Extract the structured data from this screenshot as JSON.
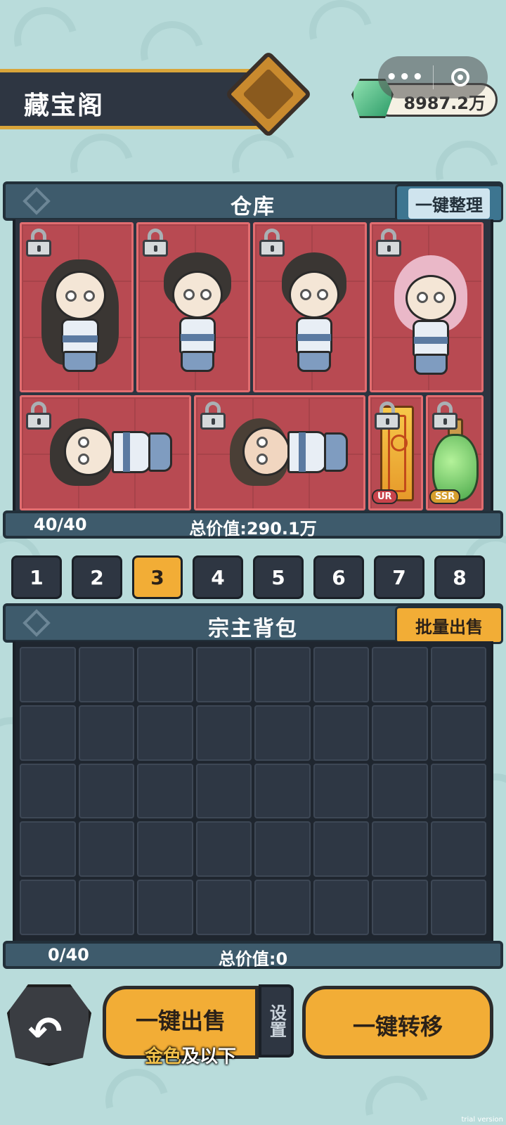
{
  "header": {
    "title": "藏宝阁",
    "currency_value": "8987.2万",
    "capsule_more": "•••"
  },
  "warehouse": {
    "title": "仓库",
    "sort_button": "一键整理",
    "count": "40/40",
    "total_value": "总价值:290.1万",
    "items": [
      {
        "type": "character",
        "locked": true
      },
      {
        "type": "character",
        "locked": true
      },
      {
        "type": "character",
        "locked": true
      },
      {
        "type": "character",
        "locked": true
      },
      {
        "type": "character",
        "locked": true
      },
      {
        "type": "character",
        "locked": true
      },
      {
        "type": "scroll",
        "locked": true,
        "rarity": "UR"
      },
      {
        "type": "bottle",
        "locked": true,
        "rarity": "SSR"
      }
    ]
  },
  "page_tabs": [
    "1",
    "2",
    "3",
    "4",
    "5",
    "6",
    "7",
    "8"
  ],
  "active_tab": "3",
  "backpack": {
    "title": "宗主背包",
    "batch_sell_button": "批量出售",
    "count": "0/40",
    "total_value": "总价值:0",
    "rows": 5,
    "columns": 8
  },
  "bottom": {
    "sell_button": "一键出售",
    "settings": "设置",
    "sell_sub_gold": "金色",
    "sell_sub_rest": "及以下",
    "transfer_button": "一键转移"
  },
  "watermark": "trial version",
  "colors": {
    "accent": "#f2ad36",
    "panel": "#3e5b6c",
    "item_bg": "#b84a52",
    "background": "#b9dcdb"
  }
}
